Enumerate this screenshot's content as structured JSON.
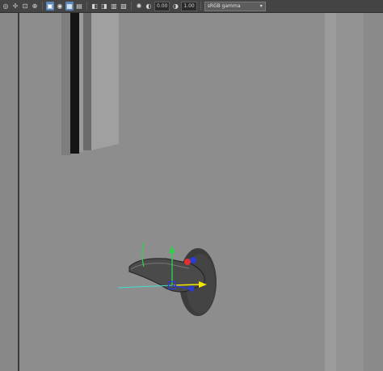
{
  "toolbar": {
    "icons": [
      "grid-icon",
      "snap-icon",
      "camera-icon",
      "isolate-icon",
      "wireframe-icon",
      "smooth-shade-icon",
      "texture-icon",
      "lights-icon",
      "shadow-icon",
      "xray-icon",
      "ssao-icon",
      "motion-blur-icon",
      "aa-icon",
      "exposure-icon",
      "gamma-icon"
    ],
    "exposure_value": "0.00",
    "gamma_value": "1.00",
    "color_space": "sRGB gamma",
    "dropdown_arrow": "▾"
  },
  "colors": {
    "viewport_bg": "#8d8d8d",
    "toolbar_bg": "#444444",
    "accent": "#5b86b7",
    "axis_x": "#e03030",
    "axis_y": "#2fd24a",
    "axis_z": "#2b3bd6",
    "manip_yellow": "#f5e800",
    "manip_cyan": "#3fe0d0"
  }
}
